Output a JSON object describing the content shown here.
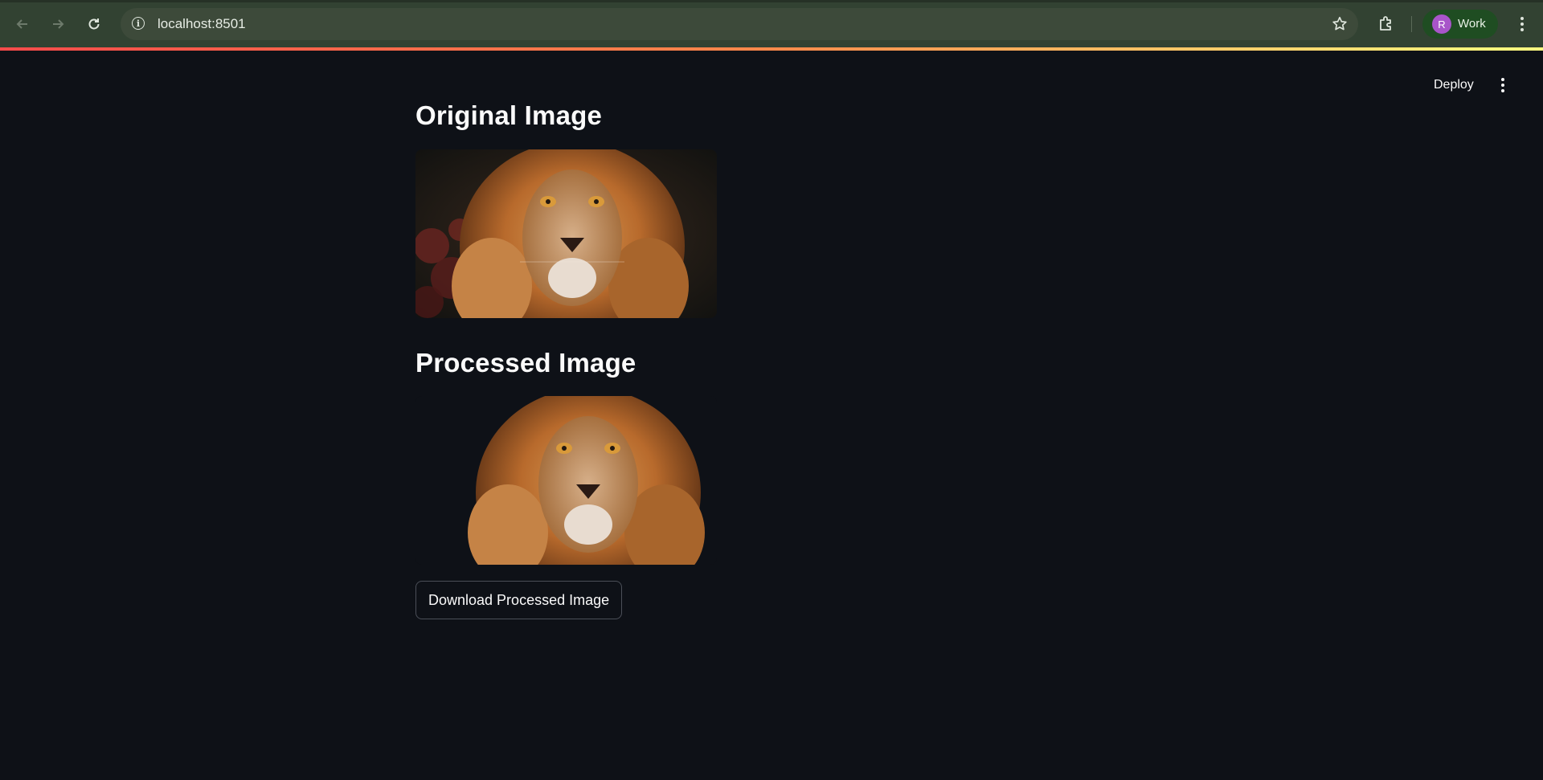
{
  "browser": {
    "url": "localhost:8501",
    "profile_initial": "R",
    "profile_label": "Work",
    "icons": [
      "back-arrow-icon",
      "forward-arrow-icon",
      "reload-icon",
      "info-icon",
      "star-icon",
      "extensions-icon",
      "kebab-menu-icon"
    ]
  },
  "app": {
    "deploy_label": "Deploy",
    "original_heading": "Original Image",
    "processed_heading": "Processed Image",
    "download_label": "Download Processed Image"
  },
  "colors": {
    "background": "#0e1117",
    "chrome": "#324232",
    "accent_gradient_start": "#ff4b4b",
    "accent_gradient_end": "#fffd80",
    "profile_avatar": "#a855c9"
  }
}
